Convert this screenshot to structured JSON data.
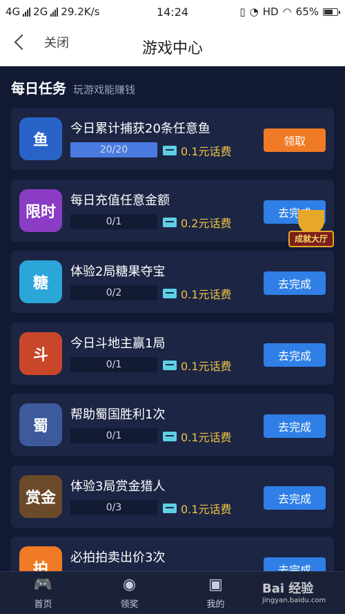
{
  "status_bar": {
    "network1": "4G",
    "network2": "2G",
    "speed": "29.2K/s",
    "time": "14:24",
    "wifi_label": "HD",
    "battery": "65%"
  },
  "header": {
    "back_label": "关闭",
    "title": "游戏中心"
  },
  "section": {
    "title": "每日任务",
    "subtitle": "玩游戏能赚钱"
  },
  "tasks": [
    {
      "title": "今日累计捕获20条任意鱼",
      "progress": "20/20",
      "progress_fraction": 1.0,
      "reward": "0.1元话费",
      "button": "领取",
      "button_type": "claim",
      "icon_color": "#2a63c8",
      "icon_glyph": "鱼"
    },
    {
      "title": "每日充值任意金额",
      "progress": "0/1",
      "progress_fraction": 0,
      "reward": "0.2元话费",
      "button": "去完成",
      "button_type": "go",
      "icon_color": "#8a3cc4",
      "icon_glyph": "限时"
    },
    {
      "title": "体验2局糖果夺宝",
      "progress": "0/2",
      "progress_fraction": 0,
      "reward": "0.1元话费",
      "button": "去完成",
      "button_type": "go",
      "icon_color": "#2aa6d8",
      "icon_glyph": "糖"
    },
    {
      "title": "今日斗地主赢1局",
      "progress": "0/1",
      "progress_fraction": 0,
      "reward": "0.1元话费",
      "button": "去完成",
      "button_type": "go",
      "icon_color": "#c8472a",
      "icon_glyph": "斗"
    },
    {
      "title": "帮助蜀国胜利1次",
      "progress": "0/1",
      "progress_fraction": 0,
      "reward": "0.1元话费",
      "button": "去完成",
      "button_type": "go",
      "icon_color": "#3c5a9c",
      "icon_glyph": "蜀"
    },
    {
      "title": "体验3局赏金猎人",
      "progress": "0/3",
      "progress_fraction": 0,
      "reward": "0.1元话费",
      "button": "去完成",
      "button_type": "go",
      "icon_color": "#6b4a2a",
      "icon_glyph": "赏金"
    },
    {
      "title": "必拍拍卖出价3次",
      "progress": "",
      "progress_fraction": 0,
      "reward": "",
      "button": "去完成",
      "button_type": "go",
      "icon_color": "#f07a25",
      "icon_glyph": "拍"
    }
  ],
  "achievement": {
    "label": "成就大厅"
  },
  "bottom_nav": [
    {
      "label": "首页",
      "icon": "gamepad-icon"
    },
    {
      "label": "领奖",
      "icon": "disc-icon"
    },
    {
      "label": "我的",
      "icon": "bag-icon"
    },
    {
      "label": "",
      "icon": "gift-icon"
    }
  ],
  "watermark": {
    "logo": "Bai 经验",
    "sub": "jingyan.baidu.com"
  }
}
